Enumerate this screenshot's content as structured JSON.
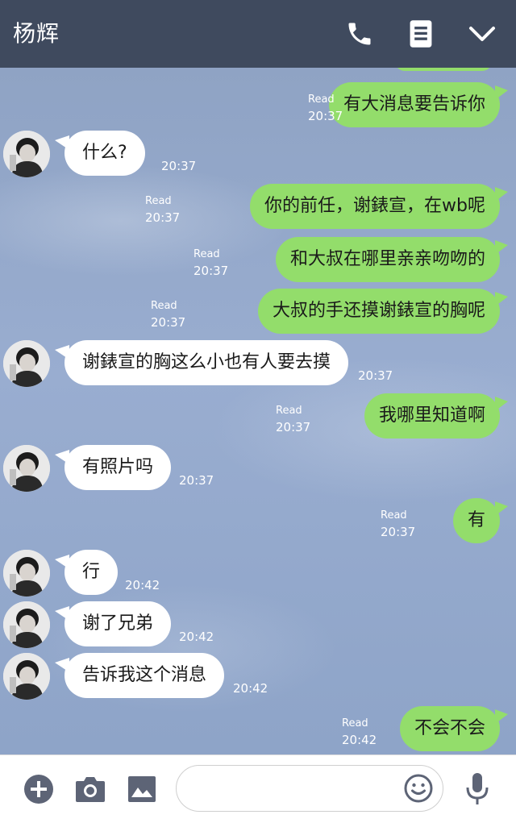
{
  "header": {
    "title": "杨辉"
  },
  "icons": {
    "phone": "phone-icon",
    "menu": "document-icon",
    "dropdown": "chevron-down-icon",
    "add": "plus-icon",
    "camera": "camera-icon",
    "image": "image-icon",
    "emoji": "smile-icon",
    "mic": "microphone-icon"
  },
  "colors": {
    "header_bg": "#3f4a5e",
    "outgoing_bubble": "#93dd6b",
    "incoming_bubble": "#ffffff"
  },
  "messages": [
    {
      "dir": "out",
      "text": "有大消息要告诉你",
      "read": "Read",
      "time": "20:37"
    },
    {
      "dir": "in",
      "text": "什么?",
      "time": "20:37"
    },
    {
      "dir": "out",
      "text": "你的前任，谢錶宣，在wb呢",
      "read": "Read",
      "time": "20:37"
    },
    {
      "dir": "out",
      "text": "和大叔在哪里亲亲吻吻的",
      "read": "Read",
      "time": "20:37"
    },
    {
      "dir": "out",
      "text": "大叔的手还摸谢錶宣的胸呢",
      "read": "Read",
      "time": "20:37"
    },
    {
      "dir": "in",
      "text": "谢錶宣的胸这么小也有人要去摸",
      "time": "20:37"
    },
    {
      "dir": "out",
      "text": "我哪里知道啊",
      "read": "Read",
      "time": "20:37"
    },
    {
      "dir": "in",
      "text": "有照片吗",
      "time": "20:37"
    },
    {
      "dir": "out",
      "text": "有",
      "read": "Read",
      "time": "20:37"
    },
    {
      "dir": "in",
      "text": "行",
      "time": "20:42"
    },
    {
      "dir": "in",
      "text": "谢了兄弟",
      "time": "20:42"
    },
    {
      "dir": "in",
      "text": "告诉我这个消息",
      "time": "20:42"
    },
    {
      "dir": "out",
      "text": "不会不会",
      "read": "Read",
      "time": "20:42"
    }
  ],
  "input": {
    "placeholder": ""
  }
}
